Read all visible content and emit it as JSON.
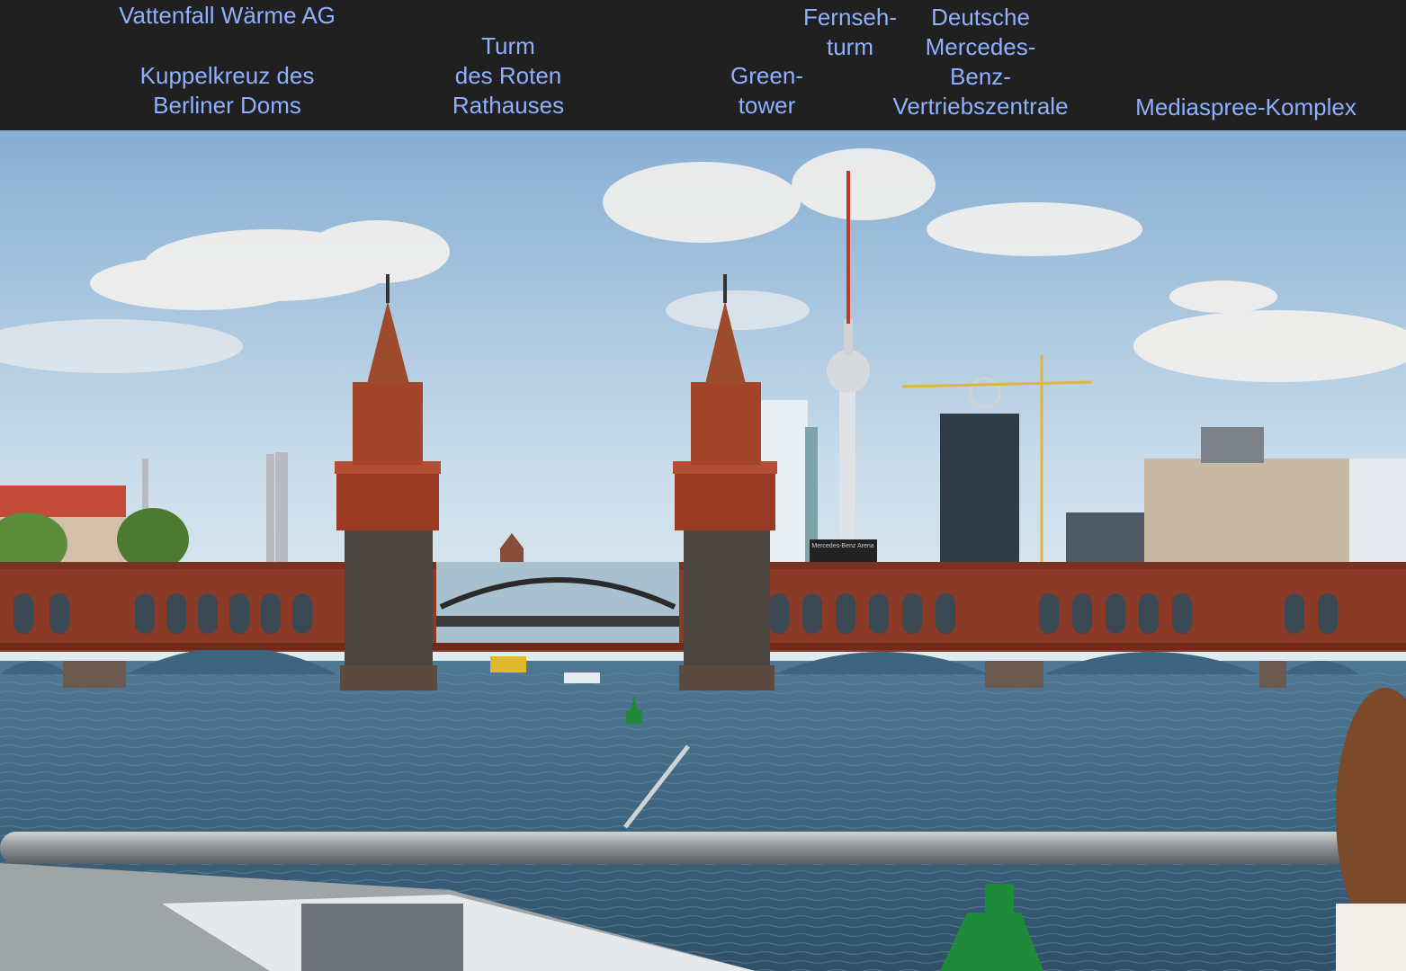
{
  "header": {
    "labels": {
      "vattenfall": "Vattenfall Wärme AG",
      "dom": "Kuppelkreuz des\nBerliner Doms",
      "rathaus": "Turm\ndes Roten\nRathauses",
      "greentower": "Green-\ntower",
      "fernsehturm": "Fernseh-\nturm",
      "mercedes": "Deutsche\nMercedes-\nBenz-\nVertriebszentrale",
      "mediaspree": "Mediaspree-Komplex"
    },
    "label_color": "#8fb0ff",
    "background": "#202020"
  },
  "photo": {
    "sign_text": "Mercedes-Benz Arena",
    "colors": {
      "sky_top": "#8fb3d6",
      "sky_bottom": "#dde8f0",
      "brick": "#8a3a26",
      "water": "#3c6380",
      "buoy": "#1f8a3a"
    }
  }
}
